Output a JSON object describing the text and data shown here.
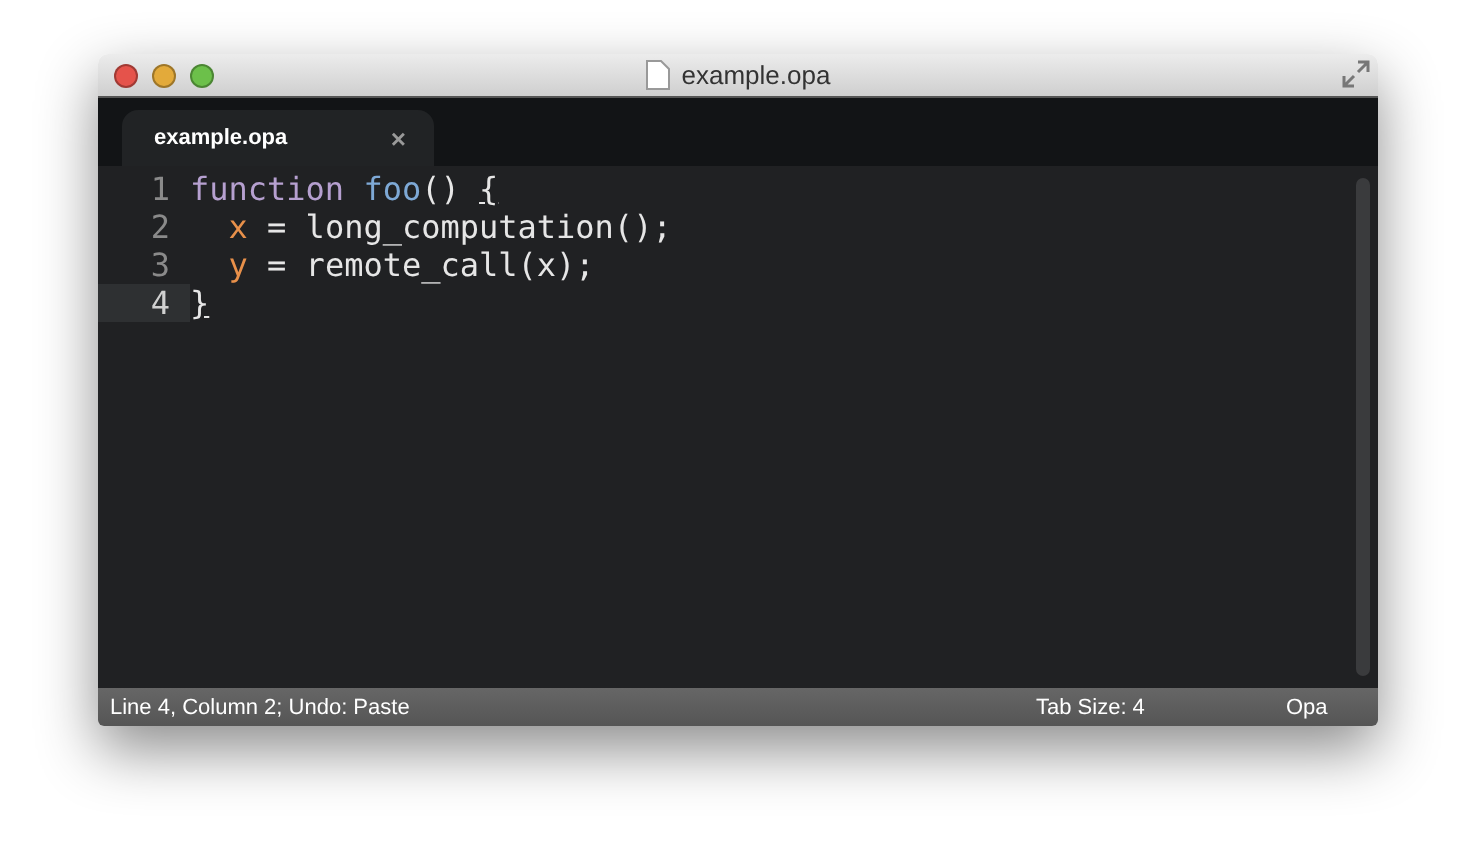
{
  "window": {
    "title": "example.opa"
  },
  "tabs": [
    {
      "label": "example.opa",
      "close": "×",
      "selected": true
    }
  ],
  "editor": {
    "lines": [
      {
        "number": "1",
        "current": false,
        "tokens": [
          {
            "text": "function ",
            "kind": "keyword"
          },
          {
            "text": "foo",
            "kind": "function"
          },
          {
            "text": "() ",
            "kind": "plain"
          },
          {
            "text": "{",
            "kind": "bracket"
          }
        ]
      },
      {
        "number": "2",
        "current": false,
        "indented": true,
        "tokens": [
          {
            "text": "x",
            "kind": "variable"
          },
          {
            "text": " = long_computation();",
            "kind": "plain"
          }
        ]
      },
      {
        "number": "3",
        "current": false,
        "indented": true,
        "tokens": [
          {
            "text": "y",
            "kind": "variable"
          },
          {
            "text": " = remote_call(x);",
            "kind": "plain"
          }
        ]
      },
      {
        "number": "4",
        "current": true,
        "tokens": [
          {
            "text": "}",
            "kind": "bracket"
          }
        ]
      }
    ]
  },
  "status_bar": {
    "position": "Line 4, Column 2; Undo: Paste",
    "tab_size": "Tab Size: 4",
    "syntax": "Opa"
  }
}
